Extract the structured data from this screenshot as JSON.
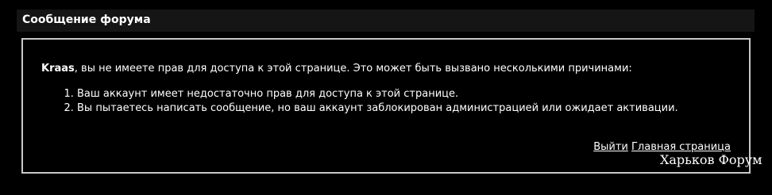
{
  "header": {
    "title": "Сообщение форума"
  },
  "message": {
    "username": "Kraas",
    "intro_rest": ", вы не имеете прав для доступа к этой странице. Это может быть вызвано несколькими причинами:",
    "reasons": [
      "Ваш аккаунт имеет недостаточно прав для доступа к этой странице.",
      "Вы пытаетесь написать сообщение, но ваш аккаунт заблокирован администрацией или ожидает активации."
    ]
  },
  "links": {
    "logout": "Выйти",
    "home": "Главная страница"
  },
  "watermark": "Харьков Форум",
  "colors": {
    "background": "#000000",
    "header_bar": "#151515",
    "border": "#c8c8c8",
    "text": "#ffffff"
  }
}
